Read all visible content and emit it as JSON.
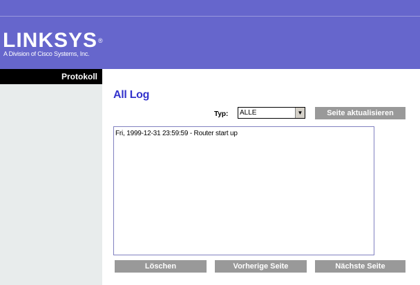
{
  "header": {
    "logo_text": "LINKSYS",
    "logo_reg": "®",
    "logo_subtitle": "A Division of Cisco Systems, Inc."
  },
  "sidebar": {
    "items": [
      {
        "label": "Protokoll"
      }
    ]
  },
  "main": {
    "title": "All Log",
    "type_label": "Typ:",
    "type_select_value": "ALLE",
    "refresh_button": "Seite aktualisieren",
    "log_entries": [
      "Fri, 1999-12-31 23:59:59 - Router start up"
    ],
    "clear_button": "Löschen",
    "prev_button": "Vorherige Seite",
    "next_button": "Nächste Seite"
  },
  "colors": {
    "header_bg": "#6666cc",
    "title_color": "#3333cc",
    "button_bg": "#999999",
    "sidebar_bg": "#e8ecec"
  },
  "icons": {
    "select_arrow": "chevron-down-icon"
  }
}
